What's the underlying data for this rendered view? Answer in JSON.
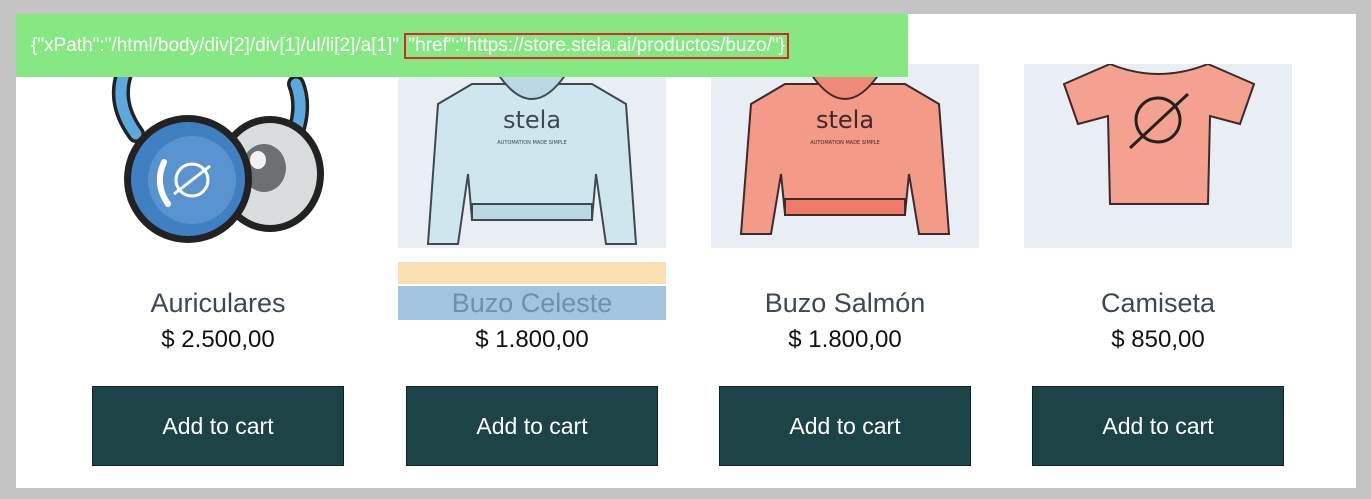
{
  "inspector": {
    "xpath_text": "{\"xPath\":\"/html/body/div[2]/div[1]/ul/li[2]/a[1]\" ",
    "href_text": "\"href\":\"https://store.stela.ai/productos/buzo/\"}"
  },
  "products": [
    {
      "name": "Auriculares",
      "price": "$ 2.500,00",
      "button": "Add to cart",
      "image_icon": "headphones-icon"
    },
    {
      "name": "Buzo Celeste",
      "price": "$ 1.800,00",
      "button": "Add to cart",
      "image_icon": "hoodie-icon",
      "brand": "stela",
      "tagline": "AUTOMATION MADE SIMPLE"
    },
    {
      "name": "Buzo Salmón",
      "price": "$ 1.800,00",
      "button": "Add to cart",
      "image_icon": "hoodie-icon",
      "brand": "stela",
      "tagline": "AUTOMATION MADE SIMPLE"
    },
    {
      "name": "Camiseta",
      "price": "$ 850,00",
      "button": "Add to cart",
      "image_icon": "tshirt-icon"
    }
  ],
  "colors": {
    "inspector_bg": "#86e883",
    "highlight_border": "#d6282b",
    "button_bg": "#1c4447",
    "hoodie_light_blue": "#cfe6ef",
    "hoodie_salmon": "#f39a88",
    "tshirt_salmon": "#f4a28f"
  }
}
